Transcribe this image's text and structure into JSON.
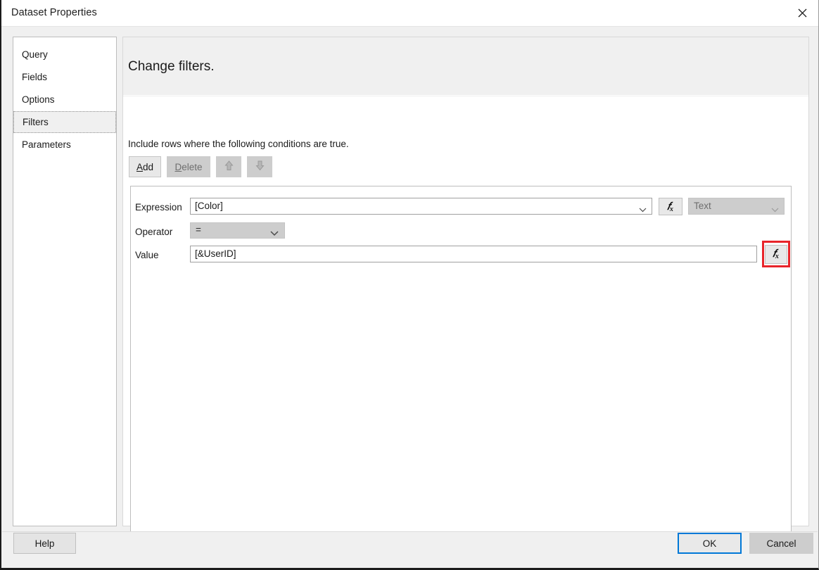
{
  "window": {
    "title": "Dataset Properties",
    "close_icon": "close-icon"
  },
  "sidebar": {
    "items": [
      {
        "label": "Query",
        "selected": false
      },
      {
        "label": "Fields",
        "selected": false
      },
      {
        "label": "Options",
        "selected": false
      },
      {
        "label": "Filters",
        "selected": true
      },
      {
        "label": "Parameters",
        "selected": false
      }
    ]
  },
  "pane": {
    "title": "Change filters.",
    "instructions": "Include rows where the following conditions are true."
  },
  "toolbar": {
    "add_label": "Add",
    "add_accesskey": "A",
    "add_rest": "dd",
    "delete_accesskey": "D",
    "delete_rest": "elete",
    "move_up_icon": "arrow-up-icon",
    "move_down_icon": "arrow-down-icon"
  },
  "filter": {
    "expression_label": "Expression",
    "expression_value": "[Color]",
    "expression_fx_icon": "fx-icon",
    "type_value": "Text",
    "operator_label": "Operator",
    "operator_value": "=",
    "value_label": "Value",
    "value_text": "[&UserID]",
    "value_fx_icon": "fx-icon"
  },
  "footer": {
    "help_label": "Help",
    "ok_label": "OK",
    "cancel_label": "Cancel"
  },
  "colors": {
    "highlight": "#e8242a",
    "focus": "#0078d7",
    "dialog_bg": "#f0f0f0",
    "disabled_bg": "#cdcdcd"
  }
}
